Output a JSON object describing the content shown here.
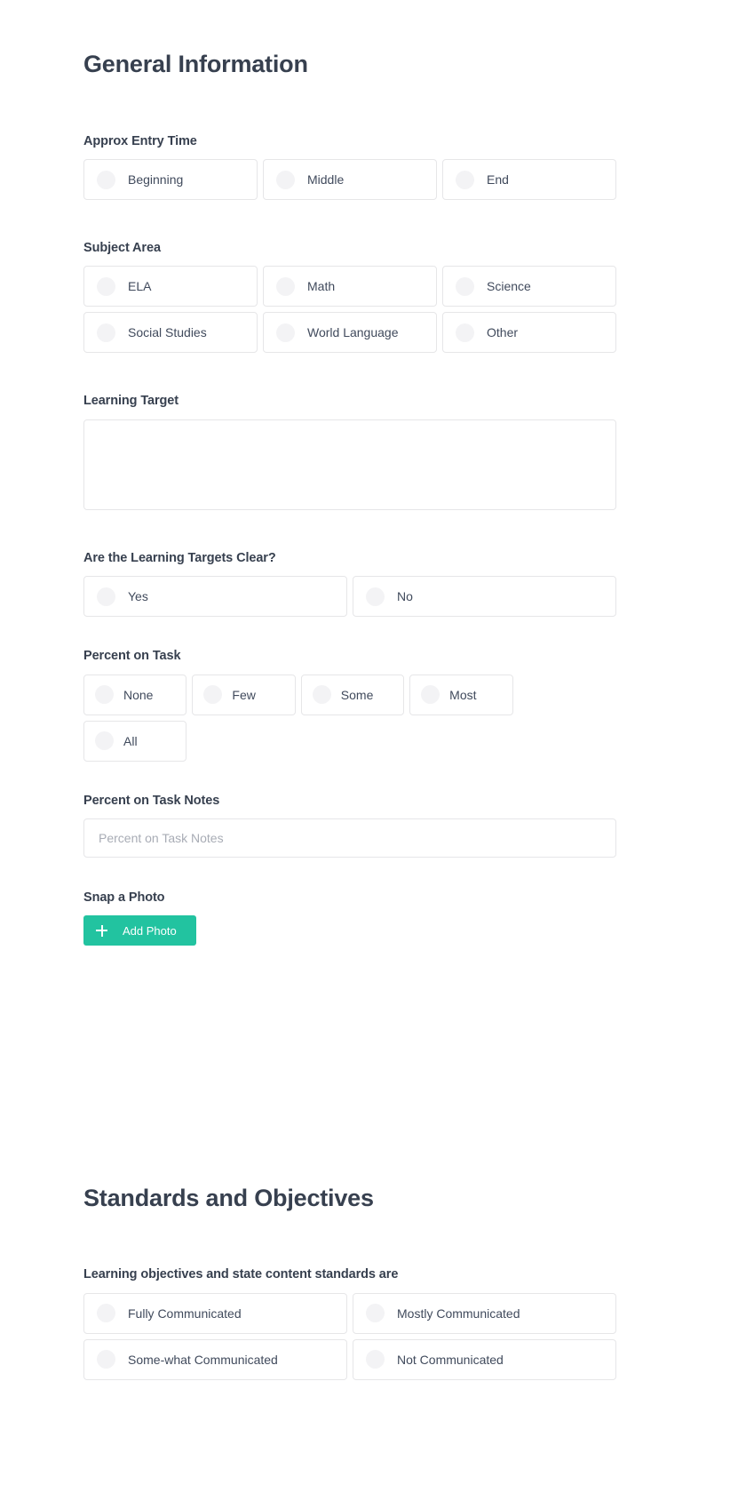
{
  "sections": [
    {
      "id": "general-information",
      "title": "General Information",
      "fields": [
        {
          "id": "approx-entry-time",
          "label": "Approx Entry Time",
          "type": "radio-group",
          "columns": 3,
          "options": [
            "Beginning",
            "Middle",
            "End"
          ]
        },
        {
          "id": "subject-area",
          "label": "Subject Area",
          "type": "radio-group",
          "columns": 3,
          "options": [
            "ELA",
            "Math",
            "Science",
            "Social Studies",
            "World Language",
            "Other"
          ]
        },
        {
          "id": "learning-target",
          "label": "Learning Target",
          "type": "textarea",
          "value": "",
          "placeholder": ""
        },
        {
          "id": "learning-targets-clear",
          "label": "Are the Learning Targets Clear?",
          "type": "radio-group",
          "columns": 2,
          "options": [
            "Yes",
            "No"
          ]
        },
        {
          "id": "percent-on-task",
          "label": "Percent on Task",
          "type": "radio-group",
          "columns": 5,
          "options": [
            "None",
            "Few",
            "Some",
            "Most",
            "All"
          ]
        },
        {
          "id": "percent-on-task-notes",
          "label": "Percent on Task Notes",
          "type": "text",
          "value": "",
          "placeholder": "Percent on Task Notes"
        },
        {
          "id": "snap-a-photo",
          "label": "Snap a Photo",
          "type": "button",
          "button_label": "Add Photo",
          "button_icon": "plus-icon"
        }
      ]
    },
    {
      "id": "standards-and-objectives",
      "title": "Standards and Objectives",
      "fields": [
        {
          "id": "objectives-communicated",
          "label": "Learning objectives and state content standards are",
          "type": "radio-group",
          "columns": 2,
          "options": [
            "Fully Communicated",
            "Mostly Communicated",
            "Some-what Communicated",
            "Not Communicated"
          ]
        }
      ]
    }
  ],
  "colors": {
    "accent_green": "#22c3a0",
    "heading_text": "#37404f",
    "body_text": "#404a5c",
    "border": "#e6e6e8",
    "radio_fill": "#f3f3f5",
    "placeholder": "#a8acb5",
    "background": "#ffffff"
  }
}
